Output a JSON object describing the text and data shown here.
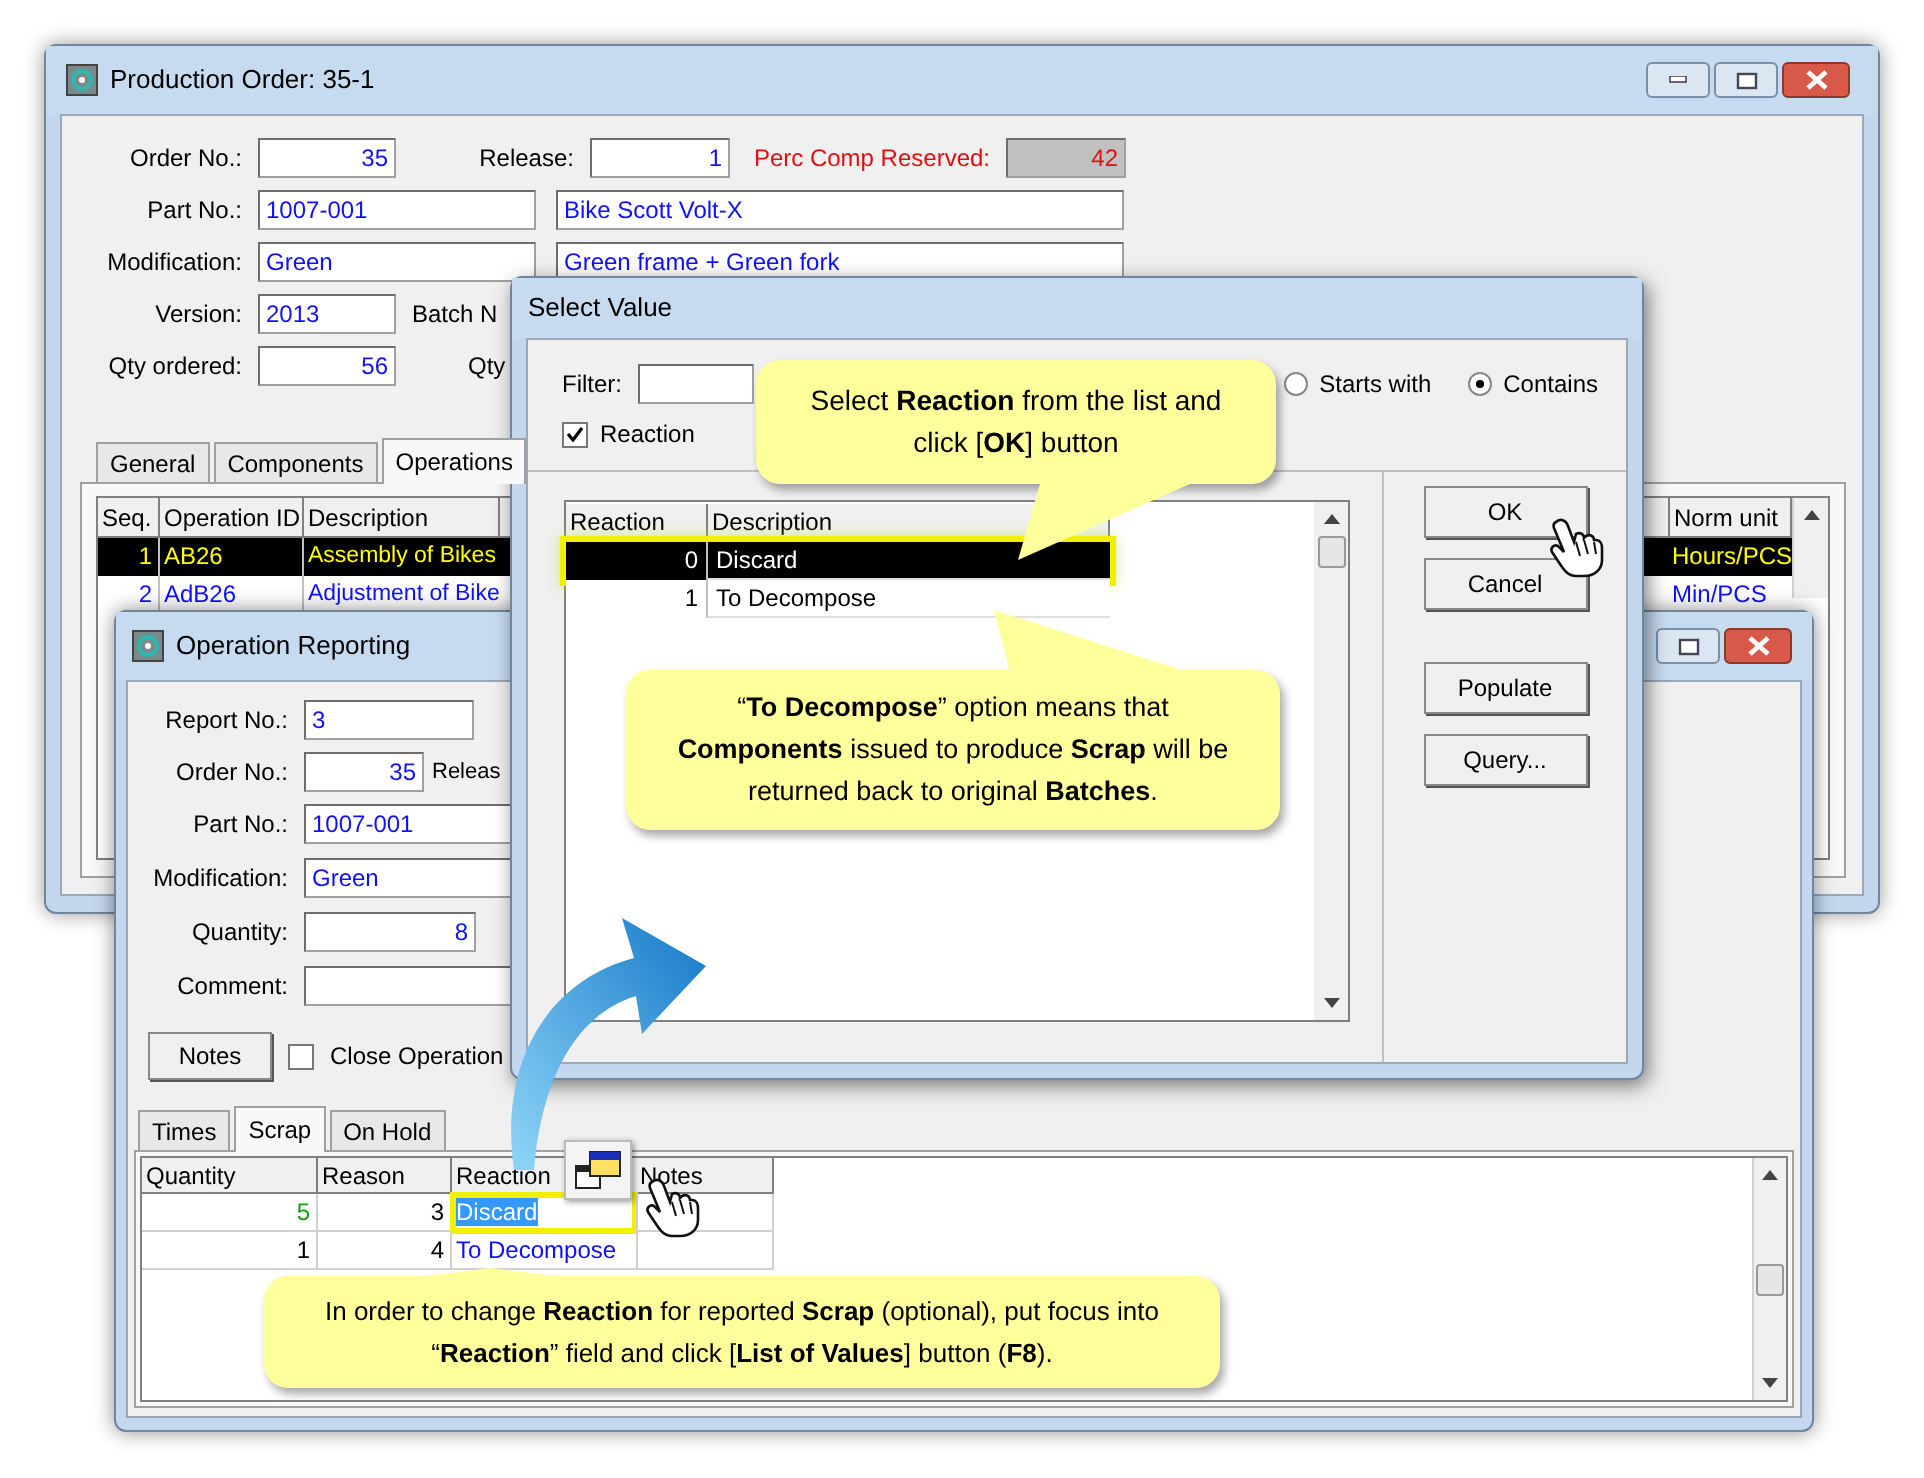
{
  "production_order": {
    "title": "Production Order: 35-1",
    "order_no": {
      "label": "Order No.:",
      "value": "35"
    },
    "release": {
      "label": "Release:",
      "value": "1"
    },
    "perc_comp_reserved": {
      "label": "Perc Comp Reserved:",
      "value": "42"
    },
    "part_no": {
      "label": "Part No.:",
      "value": "1007-001",
      "description": "Bike Scott Volt-X"
    },
    "modification": {
      "label": "Modification:",
      "value": "Green",
      "description": "Green frame + Green fork"
    },
    "version": {
      "label": "Version:",
      "value": "2013"
    },
    "batch_label": "Batch N",
    "qty_ordered": {
      "label": "Qty ordered:",
      "value": "56"
    },
    "qty_label": "Qty",
    "tabs": [
      {
        "label": "General",
        "selected": false
      },
      {
        "label": "Components",
        "selected": false
      },
      {
        "label": "Operations",
        "selected": true
      }
    ],
    "operations_table": {
      "columns": [
        "Seq.",
        "Operation ID",
        "Description",
        "Norm unit"
      ],
      "rows": [
        {
          "seq": "1",
          "operation_id": "AB26",
          "description": "Assembly of Bikes",
          "norm_unit": "Hours/PCS",
          "selected": true
        },
        {
          "seq": "2",
          "operation_id": "AdB26",
          "description": "Adjustment of Bike",
          "norm_unit": "Min/PCS",
          "selected": false
        }
      ]
    }
  },
  "operation_reporting": {
    "title": "Operation Reporting",
    "report_no": {
      "label": "Report No.:",
      "value": "3"
    },
    "order_no": {
      "label": "Order No.:",
      "value": "35"
    },
    "release_label": "Releas",
    "part_no": {
      "label": "Part No.:",
      "value": "1007-001"
    },
    "modification": {
      "label": "Modification:",
      "value": "Green"
    },
    "quantity": {
      "label": "Quantity:",
      "value": "8"
    },
    "comment": {
      "label": "Comment:"
    },
    "notes_button": "Notes",
    "close_operation": {
      "label": "Close Operation",
      "checked": false
    },
    "tabs": [
      {
        "label": "Times",
        "selected": false
      },
      {
        "label": "Scrap",
        "selected": true
      },
      {
        "label": "On Hold",
        "selected": false
      }
    ],
    "scrap_table": {
      "columns": [
        "Quantity",
        "Reason",
        "Reaction",
        "Notes"
      ],
      "rows": [
        {
          "quantity": "5",
          "reason": "3",
          "reaction": "Discard",
          "modified": true,
          "selected": true
        },
        {
          "quantity": "1",
          "reason": "4",
          "reaction": "To Decompose",
          "modified": false,
          "selected": false
        }
      ]
    }
  },
  "select_value": {
    "title": "Select Value",
    "filter_label": "Filter:",
    "match_options": [
      {
        "label": "Starts with",
        "selected": false
      },
      {
        "label": "Contains",
        "selected": true
      }
    ],
    "column_check": {
      "label": "Reaction",
      "checked": true
    },
    "columns": [
      "Reaction",
      "Description"
    ],
    "rows": [
      {
        "reaction": "0",
        "description": "Discard",
        "selected": true
      },
      {
        "reaction": "1",
        "description": "To Decompose",
        "selected": false
      }
    ],
    "buttons": [
      "OK",
      "Cancel",
      "Populate",
      "Query..."
    ]
  },
  "callouts": [
    {
      "text": "Select **Reaction** from the list and click [**OK**] button"
    },
    {
      "text": "“**To Decompose**” option means that **Components** issued to produce **Scrap** will be returned back to original **Batches**."
    },
    {
      "text": "In order to change **Reaction** for reported **Scrap** (optional), put focus into “**Reaction**” field and click [**List of Values**] button (**F8**)."
    }
  ]
}
